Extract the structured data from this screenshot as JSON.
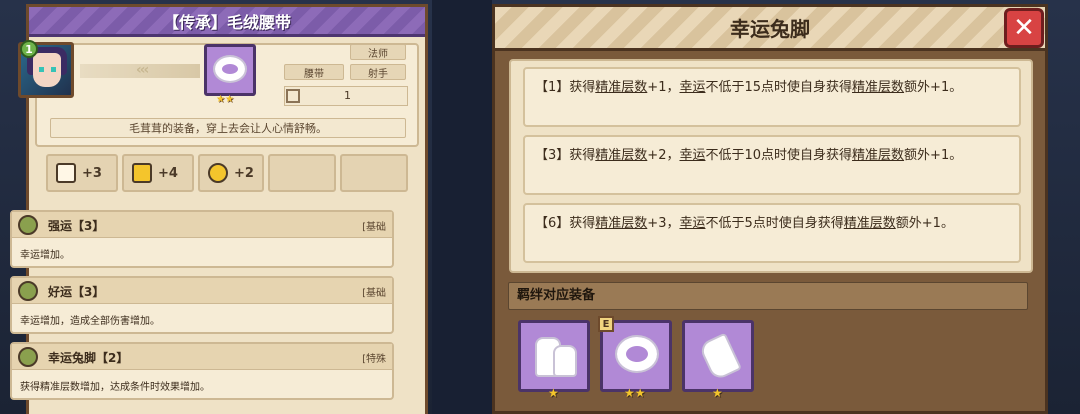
{
  "left": {
    "title": "【传承】毛绒腰带",
    "hero_level": "1",
    "arrows": "‹‹‹",
    "tags": [
      "法师",
      "腰带",
      "射手"
    ],
    "count": "1",
    "description": "毛茸茸的装备，穿上去会让人心情舒畅。",
    "stats": [
      {
        "icon": "book-icon",
        "value": "+3"
      },
      {
        "icon": "scroll-icon",
        "value": "+4"
      },
      {
        "icon": "clock-icon",
        "value": "+2"
      }
    ],
    "skills": [
      {
        "name": "强运【3】",
        "type": "[基础",
        "desc": "幸运增加。"
      },
      {
        "name": "好运【3】",
        "type": "[基础",
        "desc": "幸运增加，造成全部伤害增加。"
      },
      {
        "name": "幸运兔脚【2】",
        "type": "[特殊",
        "desc": "获得精准层数增加，达成条件时效果增加。"
      }
    ]
  },
  "right": {
    "title": "幸运兔脚",
    "close": "✕",
    "tiers": [
      {
        "prefix": "【1】获得",
        "term1": "精准层数",
        "mid1": "+1，",
        "term2": "幸运",
        "mid2": "不低于15点时使自身获得",
        "term3": "精准层数",
        "suffix": "额外+1。"
      },
      {
        "prefix": "【3】获得",
        "term1": "精准层数",
        "mid1": "+2，",
        "term2": "幸运",
        "mid2": "不低于10点时使自身获得",
        "term3": "精准层数",
        "suffix": "额外+1。"
      },
      {
        "prefix": "【6】获得",
        "term1": "精准层数",
        "mid1": "+3，",
        "term2": "幸运",
        "mid2": "不低于5点时使自身获得",
        "term3": "精准层数",
        "suffix": "额外+1。"
      }
    ],
    "bond_header": "羁绊对应装备",
    "bond_items": [
      {
        "icon": "boots-icon",
        "stars": "★"
      },
      {
        "icon": "ring-icon",
        "stars": "★★",
        "badge": "E"
      },
      {
        "icon": "glove-icon",
        "stars": "★"
      }
    ]
  },
  "colors": {
    "accent_purple": "#8d6bb8",
    "close_red": "#d84343",
    "star_gold": "#f4c52c"
  }
}
